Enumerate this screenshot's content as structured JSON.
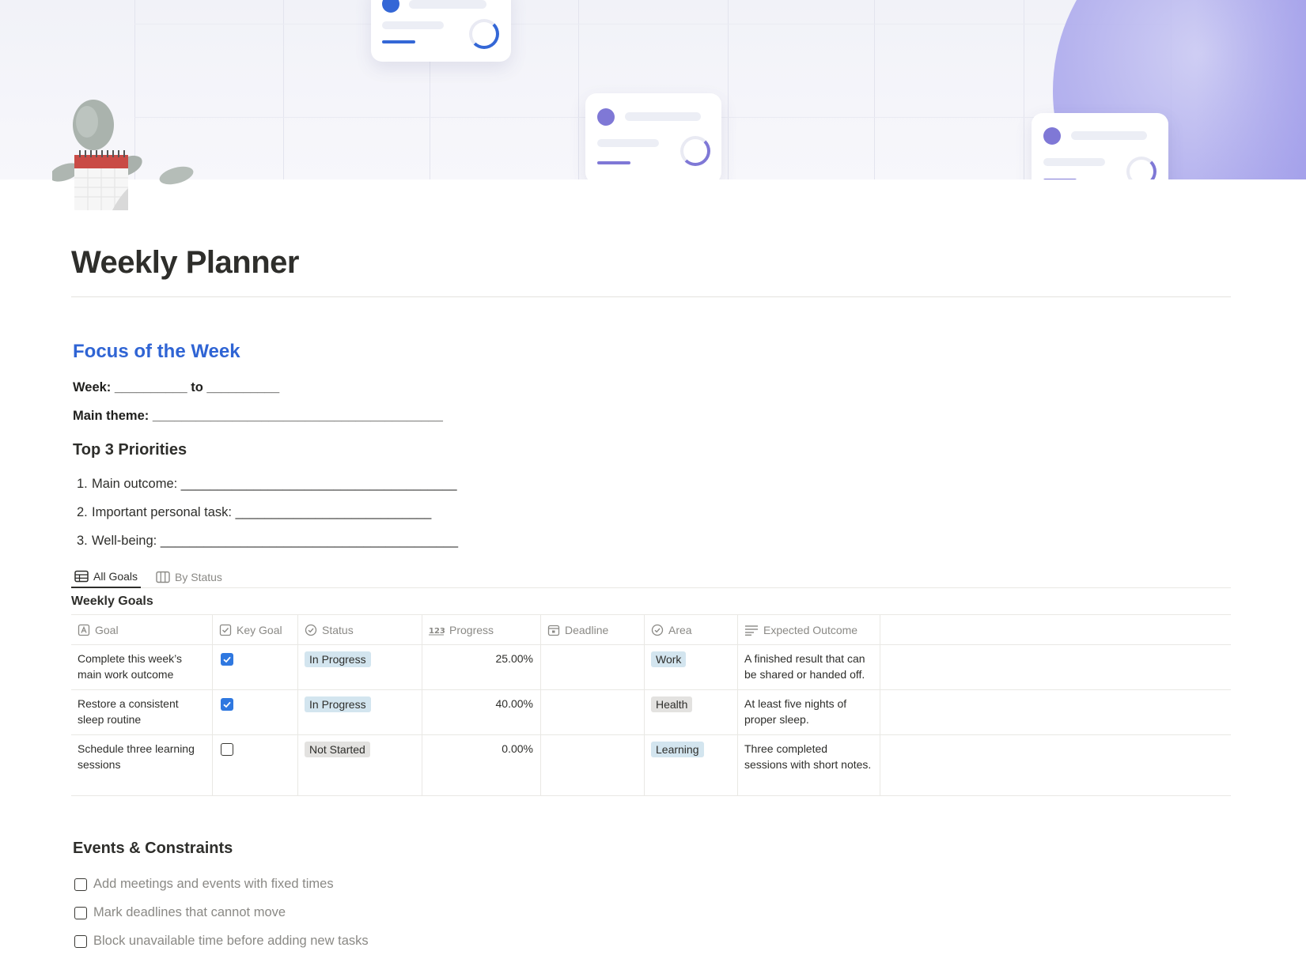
{
  "page": {
    "title": "Weekly Planner"
  },
  "focus": {
    "heading": "Focus of the Week",
    "week_line": "Week: __________ to __________",
    "theme_line": "Main theme: ________________________________________",
    "priorities_heading": "Top 3 Priorities",
    "priorities": [
      {
        "num": "1.",
        "text": "Main outcome: ______________________________________"
      },
      {
        "num": "2.",
        "text": "Important personal task: ___________________________"
      },
      {
        "num": "3.",
        "text": "Well-being: _________________________________________"
      }
    ]
  },
  "database": {
    "tabs": [
      {
        "label": "All Goals",
        "icon": "table-icon",
        "active": true
      },
      {
        "label": "By Status",
        "icon": "board-icon",
        "active": false
      }
    ],
    "title": "Weekly Goals",
    "columns": [
      {
        "label": "Goal",
        "icon": "title-property-icon"
      },
      {
        "label": "Key Goal",
        "icon": "checkbox-property-icon"
      },
      {
        "label": "Status",
        "icon": "status-property-icon"
      },
      {
        "label": "Progress",
        "icon": "number-property-icon"
      },
      {
        "label": "Deadline",
        "icon": "date-property-icon"
      },
      {
        "label": "Area",
        "icon": "status-property-icon"
      },
      {
        "label": "Expected Outcome",
        "icon": "text-property-icon"
      }
    ],
    "rows": [
      {
        "goal": "Complete this week’s main work outcome",
        "key_goal": true,
        "status": "In Progress",
        "progress": "25.00%",
        "deadline": "",
        "area": "Work",
        "outcome": "A finished result that can be shared or handed off."
      },
      {
        "goal": "Restore a consistent sleep routine",
        "key_goal": true,
        "status": "In Progress",
        "progress": "40.00%",
        "deadline": "",
        "area": "Health",
        "outcome": "At least five nights of proper sleep."
      },
      {
        "goal": "Schedule three learning sessions",
        "key_goal": false,
        "status": "Not Started",
        "progress": "0.00%",
        "deadline": "",
        "area": "Learning",
        "outcome": "Three completed sessions with short notes."
      }
    ]
  },
  "events": {
    "heading": "Events & Constraints",
    "items": [
      {
        "label": "Add meetings and events with fixed times",
        "checked": false
      },
      {
        "label": "Mark deadlines that cannot move",
        "checked": false
      },
      {
        "label": "Block unavailable time before adding new tasks",
        "checked": false
      }
    ]
  },
  "colors": {
    "accent_heading": "#2f64d4",
    "checkbox_on": "#2f78e0",
    "tag_in_progress_bg": "#d3e5ef",
    "tag_not_started_bg": "#e3e2e0",
    "tag_work_bg": "#d3e5ef",
    "tag_health_bg": "#e3e2e0",
    "tag_learning_bg": "#d3e5ef",
    "cover_accent": "#8e8ae4",
    "card_blue": "#3467d6",
    "card_purple": "#7f78d6"
  }
}
